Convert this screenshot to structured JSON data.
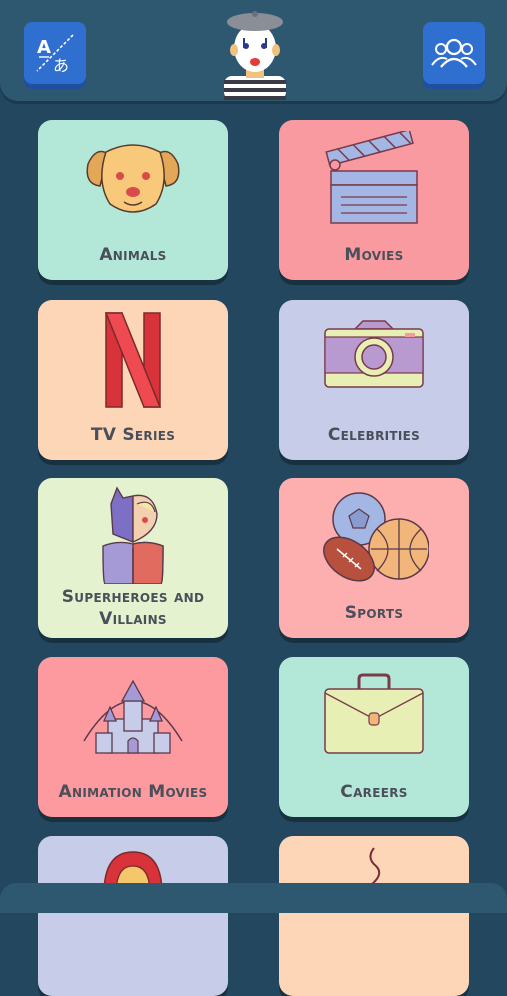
{
  "header": {
    "translate_button": "translate-icon",
    "group_button": "group-icon",
    "mascot": "mime-avatar"
  },
  "categories": [
    {
      "label": "Animals",
      "icon": "dog-icon",
      "color": "#b3e8d9"
    },
    {
      "label": "Movies",
      "icon": "clapperboard-icon",
      "color": "#f99aa0"
    },
    {
      "label": "TV Series",
      "icon": "netflix-logo-icon",
      "color": "#fdd6b8"
    },
    {
      "label": "Celebrities",
      "icon": "camera-icon",
      "color": "#c7cce9"
    },
    {
      "label": "Superheroes and Villains",
      "icon": "hero-villain-icon",
      "color": "#e4f2cf"
    },
    {
      "label": "Sports",
      "icon": "sports-balls-icon",
      "color": "#fdaeae"
    },
    {
      "label": "Animation Movies",
      "icon": "castle-icon",
      "color": "#fc9a9f"
    },
    {
      "label": "Careers",
      "icon": "briefcase-icon",
      "color": "#b3e8d9"
    },
    {
      "label": "",
      "icon": "iron-helmet-icon",
      "color": "#c7cce9"
    },
    {
      "label": "",
      "icon": "squiggle-icon",
      "color": "#fdd6b8"
    }
  ]
}
